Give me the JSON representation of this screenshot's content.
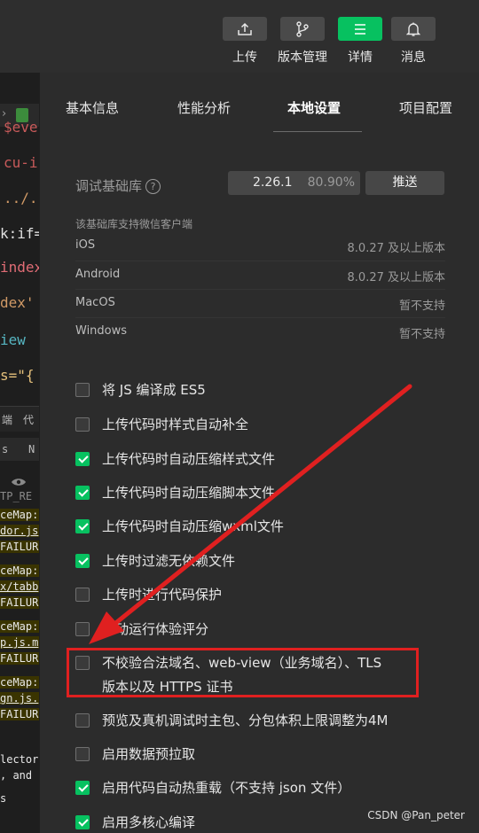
{
  "toolbar": {
    "upload": "上传",
    "version": "版本管理",
    "details": "详情",
    "messages": "消息"
  },
  "editor": {
    "code_lines": [
      "$eve",
      "cu-i",
      "../.",
      "k:if=",
      "index",
      "dex'",
      "iew",
      "s=\"{"
    ],
    "tab_row": [
      "端",
      "代"
    ],
    "row2": [
      "s",
      "N"
    ],
    "console": [
      "TP_RE",
      "ceMap:",
      "dor.js",
      "FAILUR",
      "ceMap:",
      "x/tabb",
      "FAILUR",
      "ceMap:",
      "p.js.m",
      "FAILUR",
      "ceMap:",
      "gn.js.",
      "FAILUR",
      "lector",
      ", and",
      "s"
    ]
  },
  "tabs": [
    "基本信息",
    "性能分析",
    "本地设置",
    "项目配置"
  ],
  "active_tab": "本地设置",
  "base_library": {
    "label": "调试基础库",
    "help": "?",
    "version": "2.26.1",
    "percent": "80.90%",
    "push": "推送"
  },
  "support": {
    "title": "该基础库支持微信客户端",
    "rows": [
      {
        "platform": "iOS",
        "value": "8.0.27 及以上版本"
      },
      {
        "platform": "Android",
        "value": "8.0.27 及以上版本"
      },
      {
        "platform": "MacOS",
        "value": "暂不支持"
      },
      {
        "platform": "Windows",
        "value": "暂不支持"
      }
    ]
  },
  "options": [
    {
      "label": "将 JS 编译成 ES5",
      "checked": false
    },
    {
      "label": "上传代码时样式自动补全",
      "checked": false
    },
    {
      "label": "上传代码时自动压缩样式文件",
      "checked": true
    },
    {
      "label": "上传代码时自动压缩脚本文件",
      "checked": true
    },
    {
      "label": "上传代码时自动压缩wxml文件",
      "checked": true
    },
    {
      "label": "上传时过滤无依赖文件",
      "checked": true
    },
    {
      "label": "上传时进行代码保护",
      "checked": false
    },
    {
      "label": "自动运行体验评分",
      "checked": false
    },
    {
      "label": "不校验合法域名、web-view（业务域名）、TLS",
      "label2": "版本以及 HTTPS 证书",
      "checked": false
    },
    {
      "label": "预览及真机调试时主包、分包体积上限调整为4M",
      "checked": false
    },
    {
      "label": "启用数据预拉取",
      "checked": false
    },
    {
      "label": "启用代码自动热重载（不支持 json 文件）",
      "checked": true
    },
    {
      "label": "启用多核心编译",
      "checked": true
    }
  ],
  "watermark": "CSDN @Pan_peter",
  "colors": {
    "accent": "#07c160",
    "highlight": "#e02020"
  }
}
